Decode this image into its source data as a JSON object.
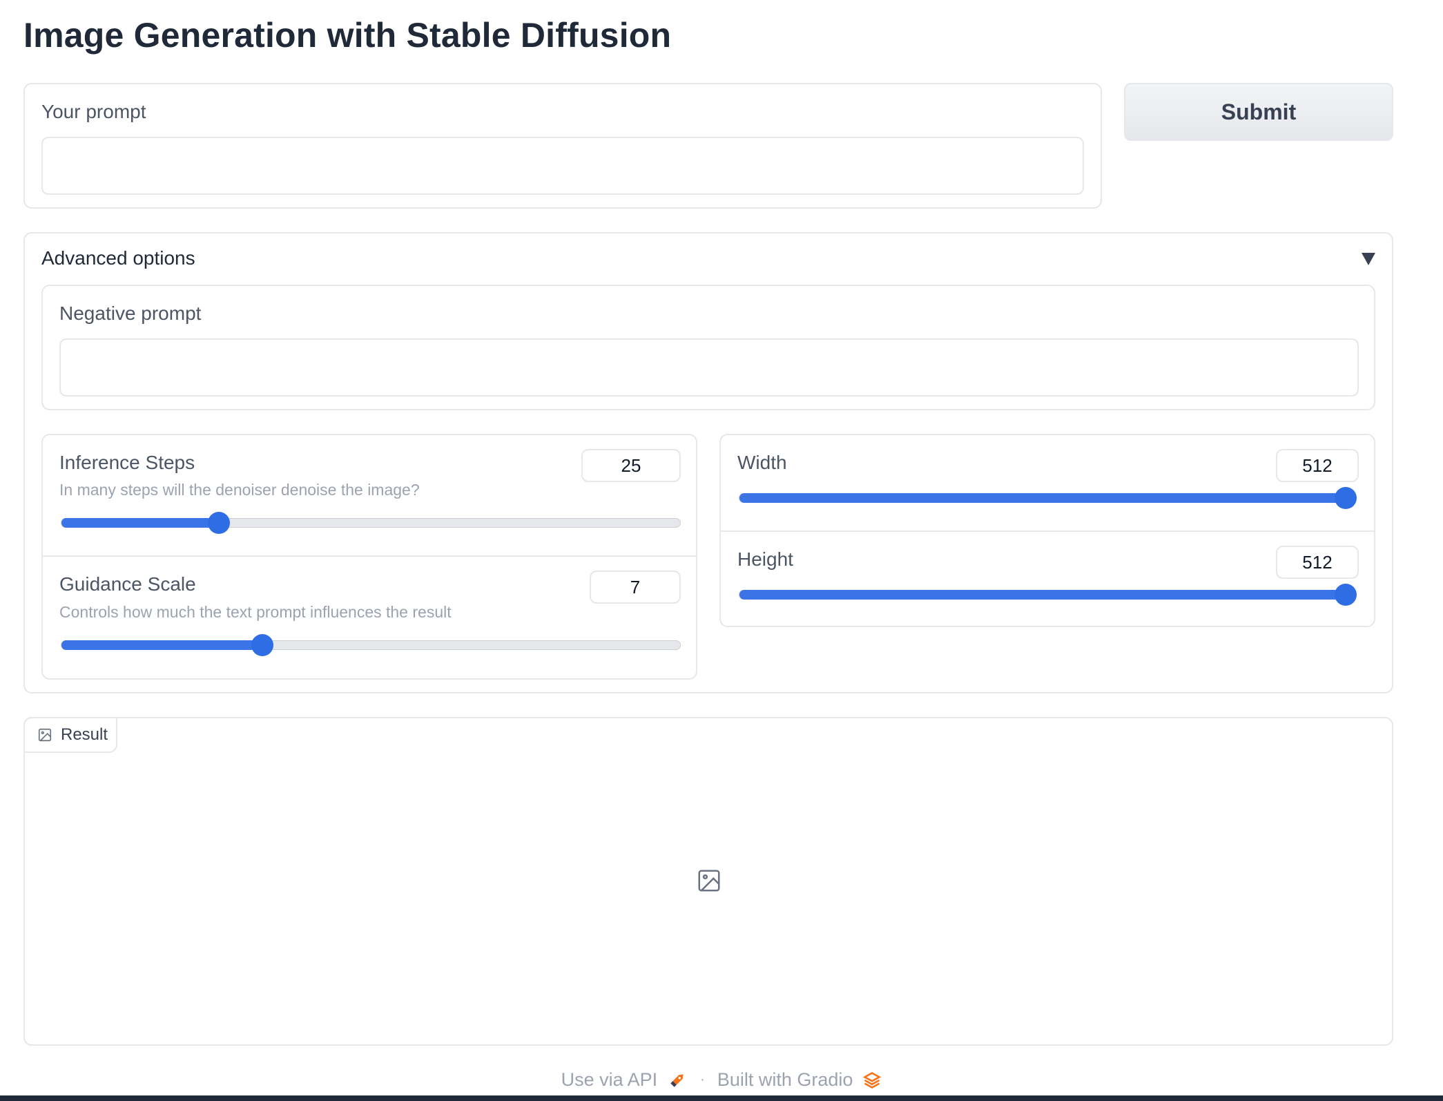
{
  "page": {
    "title": "Image Generation with Stable Diffusion"
  },
  "prompt": {
    "label": "Your prompt",
    "value": "",
    "placeholder": ""
  },
  "submit": {
    "label": "Submit"
  },
  "advanced": {
    "label": "Advanced options",
    "expanded": true,
    "negative_prompt": {
      "label": "Negative prompt",
      "value": "",
      "placeholder": ""
    },
    "inference_steps": {
      "label": "Inference Steps",
      "info": "In many steps will the denoiser denoise the image?",
      "value": "25",
      "fraction": 0.255
    },
    "guidance_scale": {
      "label": "Guidance Scale",
      "info": "Controls how much the text prompt influences the result",
      "value": "7",
      "fraction": 0.325
    },
    "width": {
      "label": "Width",
      "value": "512",
      "fraction": 1.0
    },
    "height": {
      "label": "Height",
      "value": "512",
      "fraction": 1.0
    }
  },
  "result": {
    "label": "Result",
    "icon": "image-icon"
  },
  "footer": {
    "api_label": "Use via API",
    "built_label": "Built with Gradio",
    "separator": "·"
  },
  "colors": {
    "accent": "#2f6de4",
    "border": "#e5e7eb",
    "footer_orange": "#f97316"
  }
}
